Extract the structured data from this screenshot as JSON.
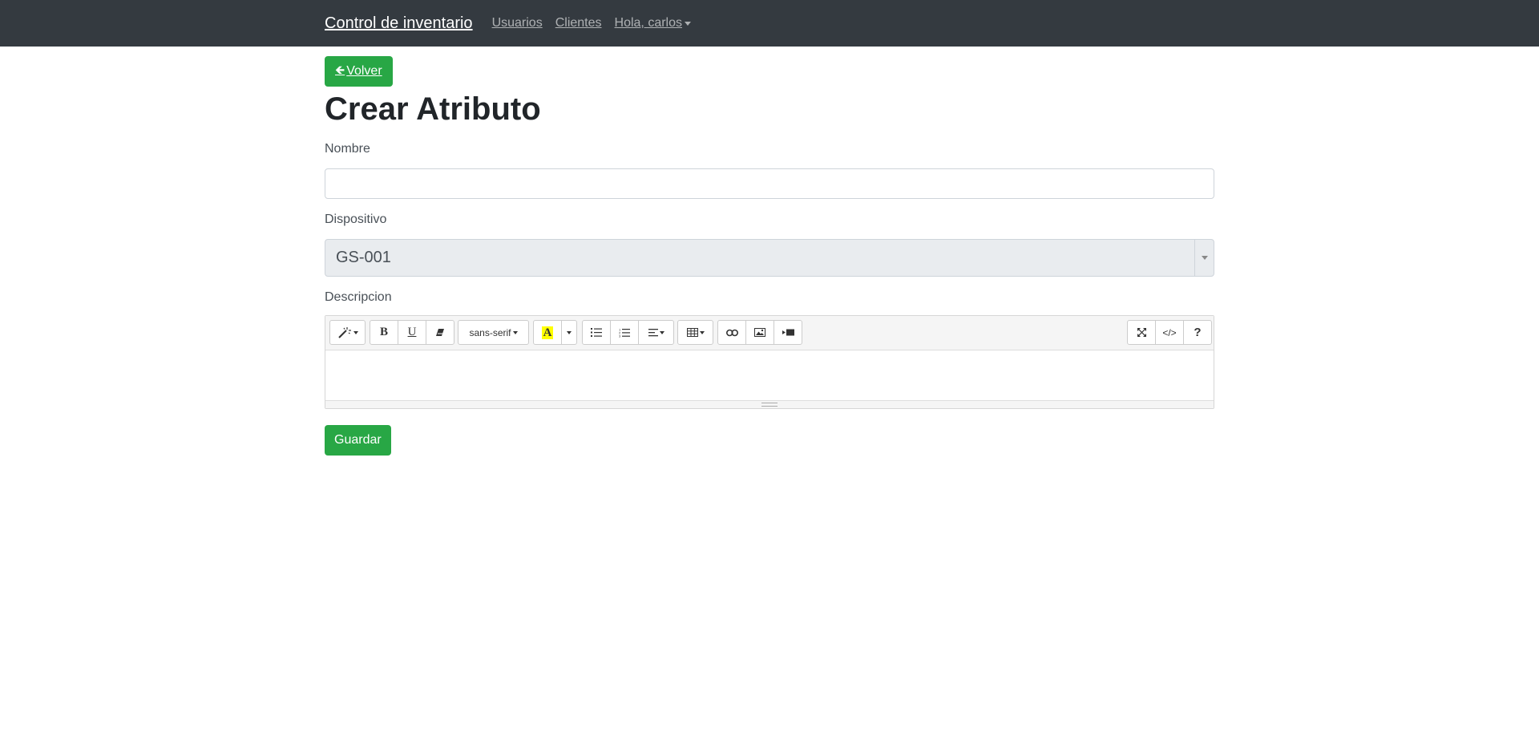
{
  "navbar": {
    "brand": "Control de inventario",
    "links": [
      "Usuarios",
      "Clientes"
    ],
    "user_menu": "Hola, carlos"
  },
  "back_button": {
    "icon": "arrow-left-icon",
    "label": "Volver"
  },
  "page_title": "Crear Atributo",
  "form": {
    "nombre_label": "Nombre",
    "nombre_value": "",
    "dispositivo_label": "Dispositivo",
    "dispositivo_value": "GS-001",
    "descripcion_label": "Descripcion",
    "editor": {
      "font_name": "sans-serif",
      "bold": "B",
      "underline": "U",
      "code_view": "</>",
      "help": "?",
      "highlight_letter": "A",
      "highlight_color": "#ffff00",
      "content": ""
    },
    "submit_label": "Guardar"
  },
  "colors": {
    "navbar": "#343a40",
    "success": "#28a745"
  }
}
